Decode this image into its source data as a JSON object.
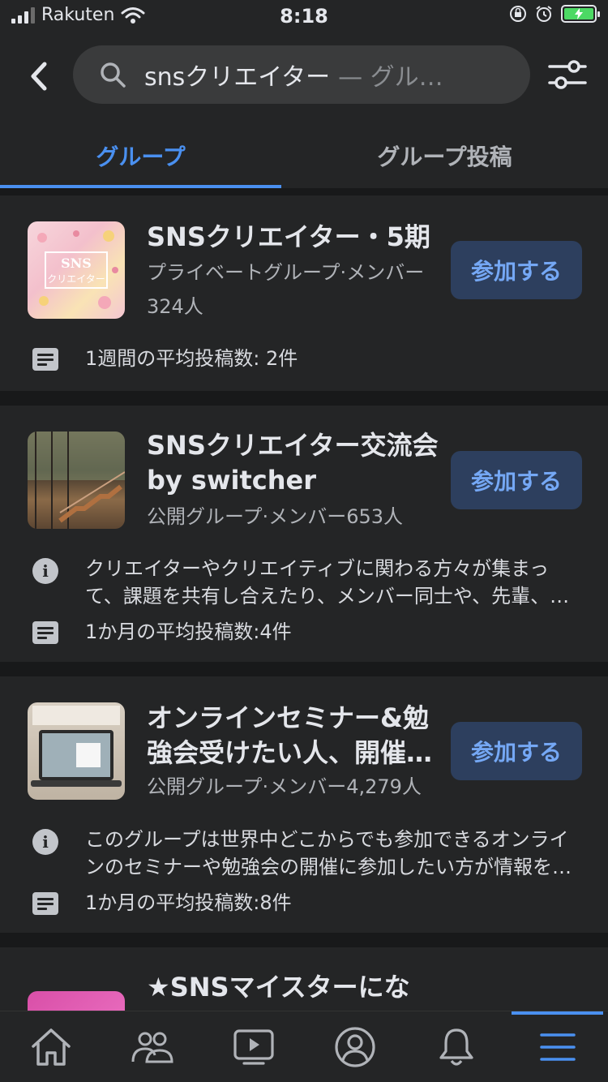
{
  "status_bar": {
    "carrier": "Rakuten",
    "time": "8:18",
    "battery_color": "#4cd964"
  },
  "search": {
    "query": "snsクリエイター",
    "suffix": "— グル…"
  },
  "tabs": [
    {
      "label": "グループ",
      "active": true
    },
    {
      "label": "グループ投稿",
      "active": false
    }
  ],
  "results": [
    {
      "title": "SNSクリエイター・5期",
      "meta_line1": "プライベートグループ·メンバー",
      "meta_line2": "324人",
      "join_label": "参加する",
      "thumb_text": "SNS",
      "thumb_subtext": "クリエイター",
      "post_stat": "1週間の平均投稿数: 2件"
    },
    {
      "title": "SNSクリエイター交流会 by switcher",
      "meta_line1": "公開グループ·メンバー653人",
      "join_label": "参加する",
      "description": "クリエイターやクリエイティブに関わる方々が集まって、課題を共有し合えたり、メンバー同士や、先輩、…",
      "post_stat": "1か月の平均投稿数:4件"
    },
    {
      "title": "オンラインセミナー&勉強会受けたい人、開催…",
      "meta_line1": "公開グループ·メンバー4,279人",
      "join_label": "参加する",
      "description": "このグループは世界中どこからでも参加できるオンラインのセミナーや勉強会の開催に参加したい方が情報を…",
      "post_stat": "1か月の平均投稿数:8件"
    },
    {
      "title": "★SNSマイスターにな"
    }
  ],
  "bottom_nav": [
    {
      "icon": "home-icon"
    },
    {
      "icon": "groups-icon"
    },
    {
      "icon": "watch-icon"
    },
    {
      "icon": "profile-icon"
    },
    {
      "icon": "notifications-icon"
    },
    {
      "icon": "menu-icon",
      "active": true
    }
  ],
  "colors": {
    "background": "#18191a",
    "card": "#242526",
    "accent": "#4a90f0",
    "join_button": "#2d3f5e",
    "join_text": "#75a8f5"
  }
}
